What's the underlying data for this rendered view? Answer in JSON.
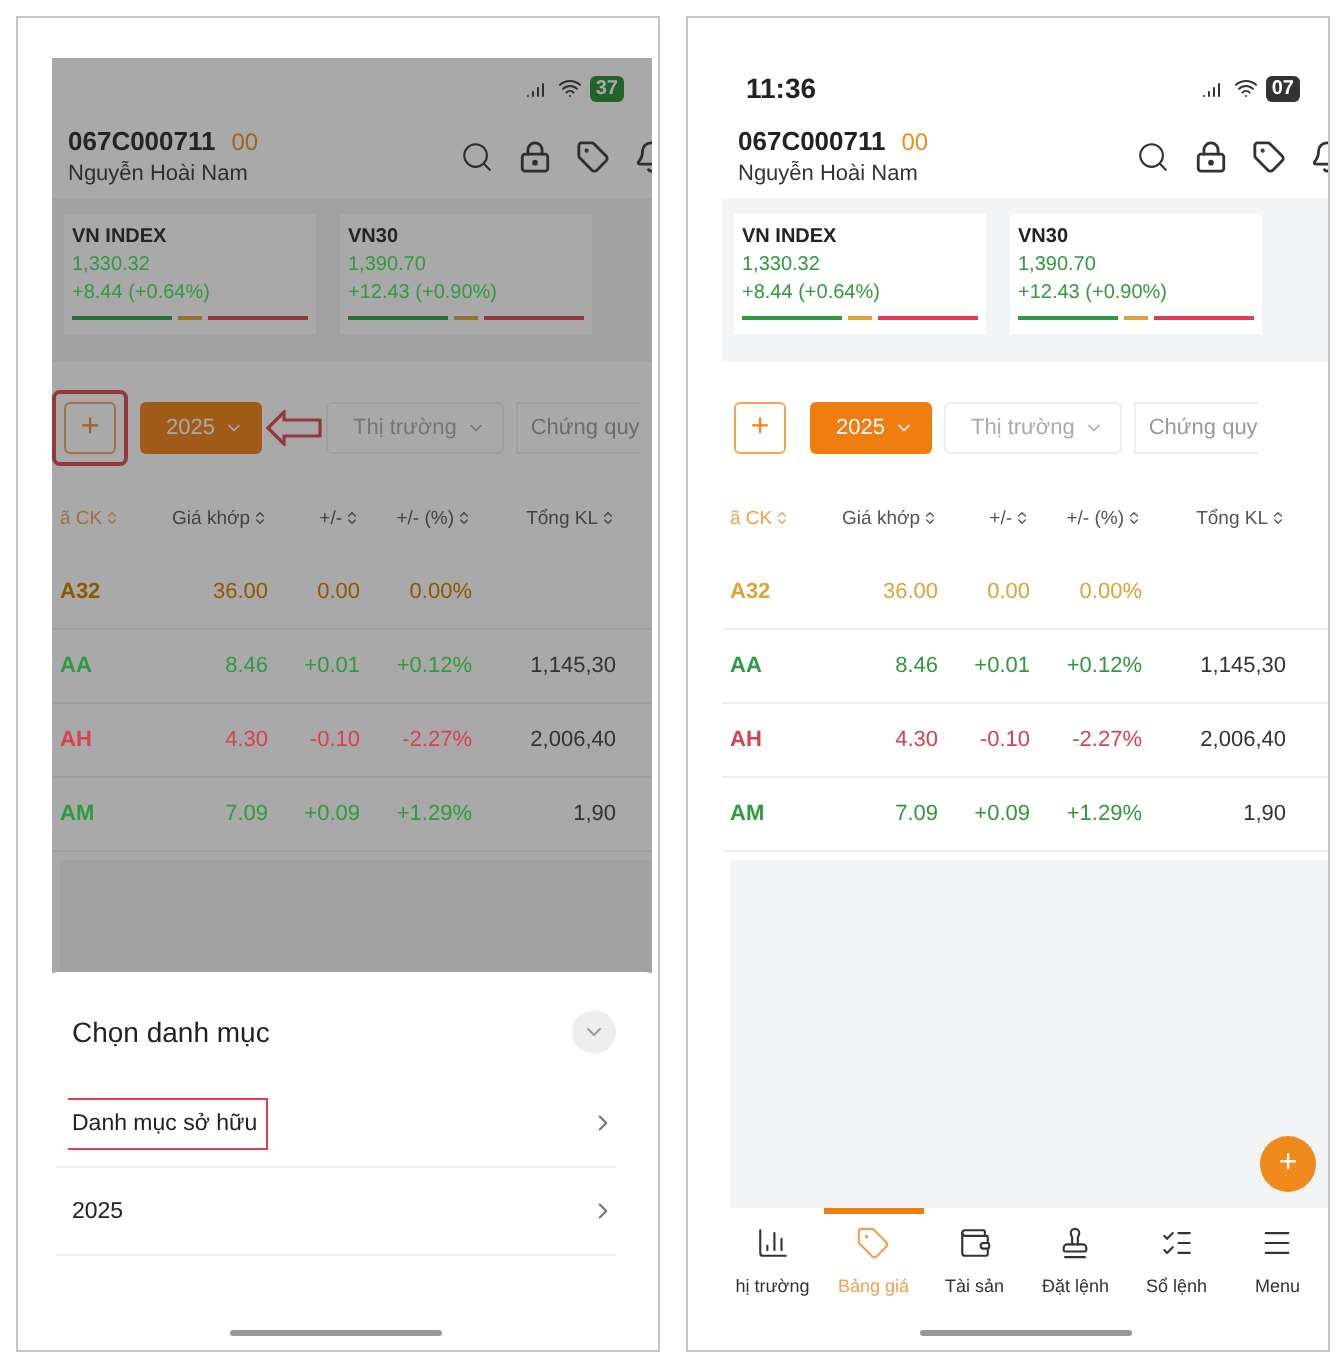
{
  "screens": [
    {
      "kind": "with-sheet",
      "status": {
        "battery": "37",
        "charging": true
      },
      "account": {
        "id": "067C000711",
        "sub": "00",
        "name": "Nguyễn Hoài Nam"
      },
      "indices": [
        {
          "name": "VN INDEX",
          "value": "1,330.32",
          "change": "+8.44 (+0.64%)",
          "color": "#2f9a3e"
        },
        {
          "name": "VN30",
          "value": "1,390.70",
          "change": "+12.43 (+0.90%)",
          "color": "#2f9a3e"
        }
      ],
      "filters": {
        "add": {
          "label": "+",
          "annotated": true
        },
        "watchlist": "2025",
        "arrow_annotation": true,
        "market": "Thị trường",
        "other": "Chứng quy"
      },
      "columns": [
        {
          "label": "ã CK",
          "sorted": true
        },
        {
          "label": "Giá khớp",
          "sorted": false
        },
        {
          "label": "+/-",
          "sorted": false
        },
        {
          "label": "+/- (%)",
          "sorted": false
        },
        {
          "label": "Tổng KL",
          "sorted": false
        }
      ],
      "rows": [
        {
          "symbol": "A32",
          "price": "36.00",
          "change": "0.00",
          "percent": "0.00%",
          "color": "#8a5a00"
        },
        {
          "symbol": "AA",
          "price": "8.46",
          "change": "+0.01",
          "percent": "+0.12%",
          "volume": "1,145,30",
          "color": "#2f9a3e"
        },
        {
          "symbol": "AH",
          "price": "4.30",
          "change": "-0.10",
          "percent": "-2.27%",
          "volume": "2,006,40",
          "color": "#d8414e"
        },
        {
          "symbol": "AM",
          "price": "7.09",
          "change": "+0.09",
          "percent": "+1.29%",
          "volume": "1,90",
          "color": "#2f9a3e"
        }
      ],
      "sheet": {
        "title": "Chọn danh mục",
        "items": [
          {
            "label": "Danh mục sở hữu",
            "annotated": true
          },
          {
            "label": "2025",
            "annotated": false
          }
        ]
      }
    },
    {
      "kind": "plain",
      "status": {
        "time": "11:36",
        "battery": "07",
        "charging": false
      },
      "account": {
        "id": "067C000711",
        "sub": "00",
        "name": "Nguyễn Hoài Nam"
      },
      "indices": [
        {
          "name": "VN INDEX",
          "value": "1,330.32",
          "change": "+8.44 (+0.64%)",
          "color": "#2f9a3e"
        },
        {
          "name": "VN30",
          "value": "1,390.70",
          "change": "+12.43 (+0.90%)",
          "color": "#2f9a3e"
        }
      ],
      "filters": {
        "add": {
          "label": "+",
          "annotated": false
        },
        "watchlist": "2025",
        "market": "Thị trường",
        "other": "Chứng quy"
      },
      "columns": [
        {
          "label": "ã CK",
          "sorted": true
        },
        {
          "label": "Giá khớp",
          "sorted": false
        },
        {
          "label": "+/-",
          "sorted": false
        },
        {
          "label": "+/- (%)",
          "sorted": false
        },
        {
          "label": "Tổng KL",
          "sorted": false
        }
      ],
      "rows": [
        {
          "symbol": "A32",
          "price": "36.00",
          "change": "0.00",
          "percent": "0.00%",
          "color": "#e0a23a"
        },
        {
          "symbol": "AA",
          "price": "8.46",
          "change": "+0.01",
          "percent": "+0.12%",
          "volume": "1,145,30",
          "color": "#2f9a3e"
        },
        {
          "symbol": "AH",
          "price": "4.30",
          "change": "-0.10",
          "percent": "-2.27%",
          "volume": "2,006,40",
          "color": "#d8414e"
        },
        {
          "symbol": "AM",
          "price": "7.09",
          "change": "+0.09",
          "percent": "+1.29%",
          "volume": "1,90",
          "color": "#2f9a3e"
        }
      ],
      "fab": "+",
      "nav": [
        {
          "label": "hị trường",
          "selected": false
        },
        {
          "label": "Bảng giá",
          "selected": true
        },
        {
          "label": "Tài sản",
          "selected": false
        },
        {
          "label": "Đặt lệnh",
          "selected": false
        },
        {
          "label": "Sổ lệnh",
          "selected": false
        },
        {
          "label": "Menu",
          "selected": false
        }
      ]
    }
  ]
}
